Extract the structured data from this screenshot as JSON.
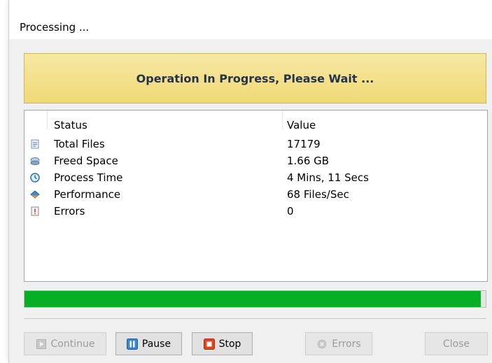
{
  "window": {
    "title": "Processing ..."
  },
  "banner": {
    "text": "Operation In Progress, Please Wait ..."
  },
  "list": {
    "columns": [
      "Status",
      "Value"
    ],
    "rows": [
      {
        "icon": "document-icon",
        "label": "Total Files",
        "value": "17179"
      },
      {
        "icon": "disk-icon",
        "label": "Freed Space",
        "value": "1.66 GB"
      },
      {
        "icon": "clock-icon",
        "label": "Process Time",
        "value": "4 Mins, 11 Secs"
      },
      {
        "icon": "speed-icon",
        "label": "Performance",
        "value": "68 Files/Sec"
      },
      {
        "icon": "error-log-icon",
        "label": "Errors",
        "value": "0"
      }
    ]
  },
  "progress": {
    "percent": 99,
    "color": "#06b025"
  },
  "buttons": {
    "continue": {
      "label": "Continue",
      "enabled": false
    },
    "pause": {
      "label": "Pause",
      "enabled": true
    },
    "stop": {
      "label": "Stop",
      "enabled": true
    },
    "errors": {
      "label": "Errors",
      "enabled": false
    },
    "close": {
      "label": "Close",
      "enabled": false
    }
  }
}
